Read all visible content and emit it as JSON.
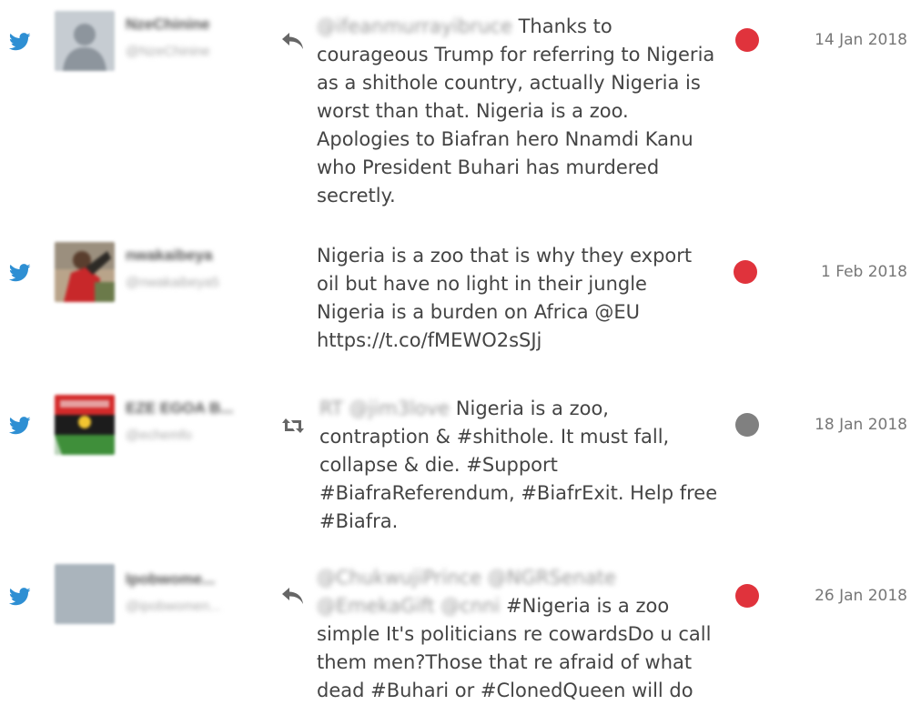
{
  "colors": {
    "twitter_blue": "#2e8fd3",
    "sentiment_negative": "#e0333c",
    "sentiment_neutral": "#808080",
    "icon_gray": "#666666"
  },
  "tweets": [
    {
      "network_icon": "twitter-bird-icon",
      "avatar": "default-silhouette",
      "user_name": "NzeChinine",
      "user_handle": "@NzeChinine",
      "action_icon": "reply-icon",
      "mention_prefix": "@ifeanmurrayibruce",
      "text": "Thanks to courageous Trump for referring to Nigeria as a shithole country, actually Nigeria is worst than that. Nigeria is a zoo. Apologies to Biafran hero Nnamdi Kanu who President Buhari has murdered secretly.",
      "sentiment_color": "#e0333c",
      "date": "14 Jan 2018"
    },
    {
      "network_icon": "twitter-bird-icon",
      "avatar": "photo-person",
      "user_name": "nwakaibeya",
      "user_handle": "@nwakaibeya5",
      "action_icon": "",
      "mention_prefix": "",
      "text": "Nigeria is a zoo that is why they export oil but have no light in their jungle Nigeria is a burden on Africa @EU https://t.co/fMEWO2sSJj",
      "sentiment_color": "#e0333c",
      "date": "1 Feb 2018"
    },
    {
      "network_icon": "twitter-bird-icon",
      "avatar": "biafra-flag",
      "user_name": "EZE EGOA B...",
      "user_handle": "@echemfo",
      "action_icon": "retweet-icon",
      "mention_prefix": "RT @jim3love",
      "text": "Nigeria is a zoo, contraption & #shithole. It must fall, collapse & die. #Support #BiafraReferendum, #BiafrExit. Help free #Biafra.",
      "sentiment_color": "#808080",
      "date": "18 Jan 2018"
    },
    {
      "network_icon": "twitter-bird-icon",
      "avatar": "gray-placeholder",
      "user_name": "Ipobwome...",
      "user_handle": "@ipobwomen...",
      "action_icon": "reply-icon",
      "mention_prefix": "@ChukwujiPrince @NGRSenate @EmekaGift @cnni",
      "text": "#Nigeria is a zoo simple It's politicians re cowardsDo u call them men?Those that re afraid of what dead #Buhari or #ClonedQueen will do",
      "sentiment_color": "#e0333c",
      "date": "26 Jan 2018"
    }
  ]
}
